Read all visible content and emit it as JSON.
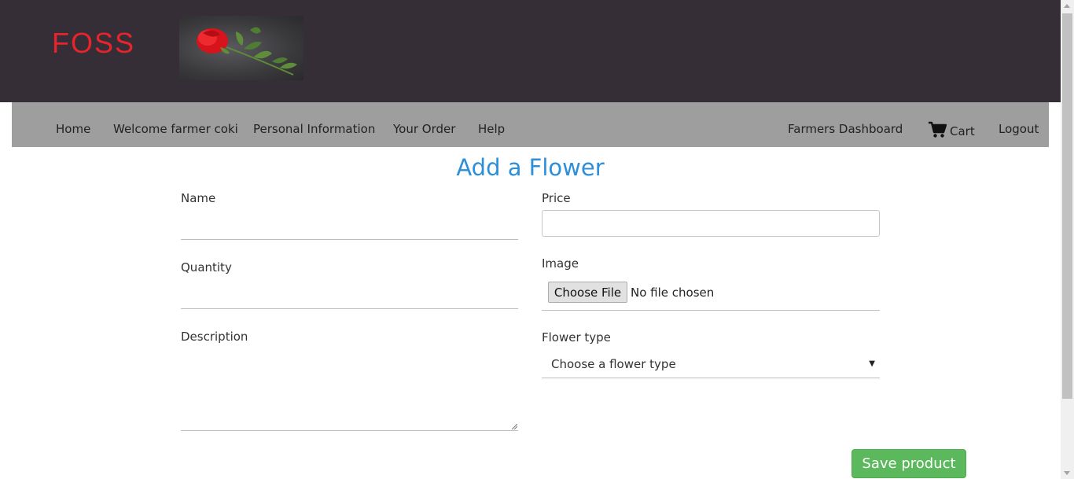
{
  "header": {
    "brand": "FOSS",
    "brand_color": "#e8232b",
    "background": "#352e37",
    "logo_image": "rose-image"
  },
  "nav": {
    "left": [
      {
        "label": "Home"
      },
      {
        "label": "Welcome farmer coki"
      },
      {
        "label": "Personal Information"
      },
      {
        "label": "Your Order"
      },
      {
        "label": "Help"
      }
    ],
    "right": {
      "dashboard": "Farmers Dashboard",
      "cart_icon": "shopping-cart-icon",
      "cart": "Cart",
      "logout": "Logout"
    },
    "background": "#9e9e9e"
  },
  "form": {
    "title": "Add a Flower",
    "title_color": "#2b8fd9",
    "name_label": "Name",
    "name_value": "",
    "price_label": "Price",
    "price_value": "",
    "quantity_label": "Quantity",
    "quantity_value": "",
    "image_label": "Image",
    "file_button": "Choose File",
    "file_status": "No file chosen",
    "description_label": "Description",
    "description_value": "",
    "flower_type_label": "Flower type",
    "flower_type_selected": "Choose a flower type",
    "save_button": "Save product",
    "save_color": "#5cb85c"
  }
}
